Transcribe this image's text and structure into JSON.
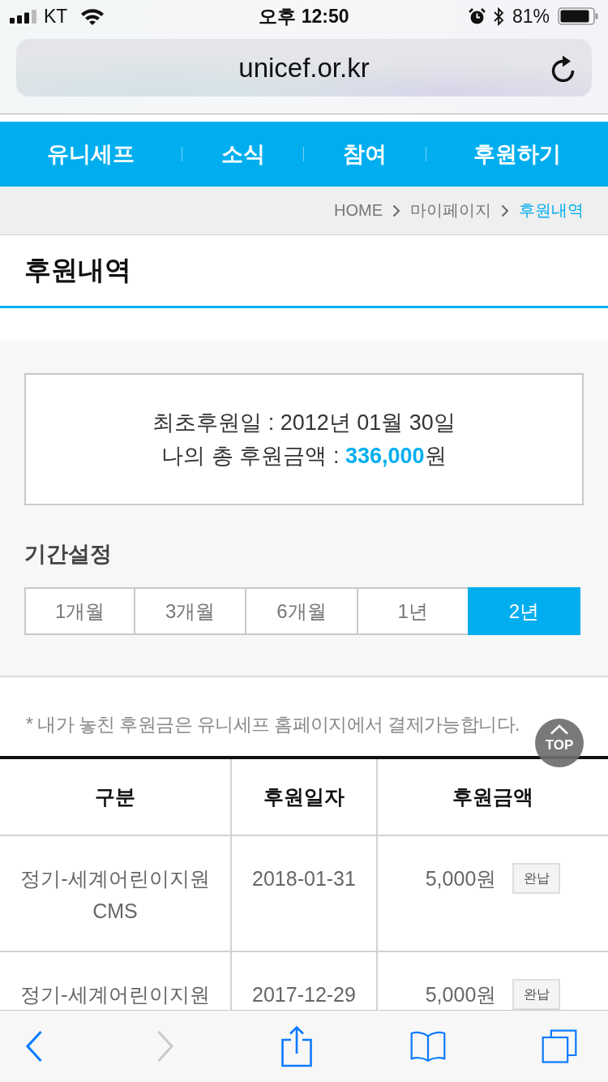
{
  "status_bar": {
    "carrier": "KT",
    "time": "오후 12:50",
    "battery": "81%"
  },
  "address_bar": {
    "url": "unicef.or.kr"
  },
  "nav": [
    "유니세프",
    "소식",
    "참여",
    "후원하기"
  ],
  "breadcrumb": [
    {
      "label": "HOME",
      "current": false
    },
    {
      "label": "마이페이지",
      "current": false
    },
    {
      "label": "후원내역",
      "current": true
    }
  ],
  "page_title": "후원내역",
  "summary": {
    "first_donation": "최초후원일 : 2012년 01월 30일",
    "total": "나의 총 후원금액 : **336,000**원"
  },
  "period": {
    "title": "기간설정",
    "options": [
      {
        "label": "1개월",
        "selected": false
      },
      {
        "label": "3개월",
        "selected": false
      },
      {
        "label": "6개월",
        "selected": false
      },
      {
        "label": "1년",
        "selected": false
      },
      {
        "label": "2년",
        "selected": true
      }
    ]
  },
  "note": "* 내가 놓친 후원금은 유니세프 홈페이지에서 결제가능합니다.",
  "top_button": {
    "label": "TOP"
  },
  "table": {
    "columns": [
      "구분",
      "후원일자",
      "후원금액"
    ],
    "rows": [
      {
        "category": "정기-세계어린이지원 CMS",
        "date": "2018-01-31",
        "amount": "5,000원",
        "status": "완납"
      },
      {
        "category": "정기-세계어린이지원",
        "date": "2017-12-29",
        "amount": "5,000원",
        "status": "완납"
      }
    ]
  },
  "toolbar": {
    "back": {
      "disabled": false
    },
    "forward": {
      "disabled": true
    }
  }
}
